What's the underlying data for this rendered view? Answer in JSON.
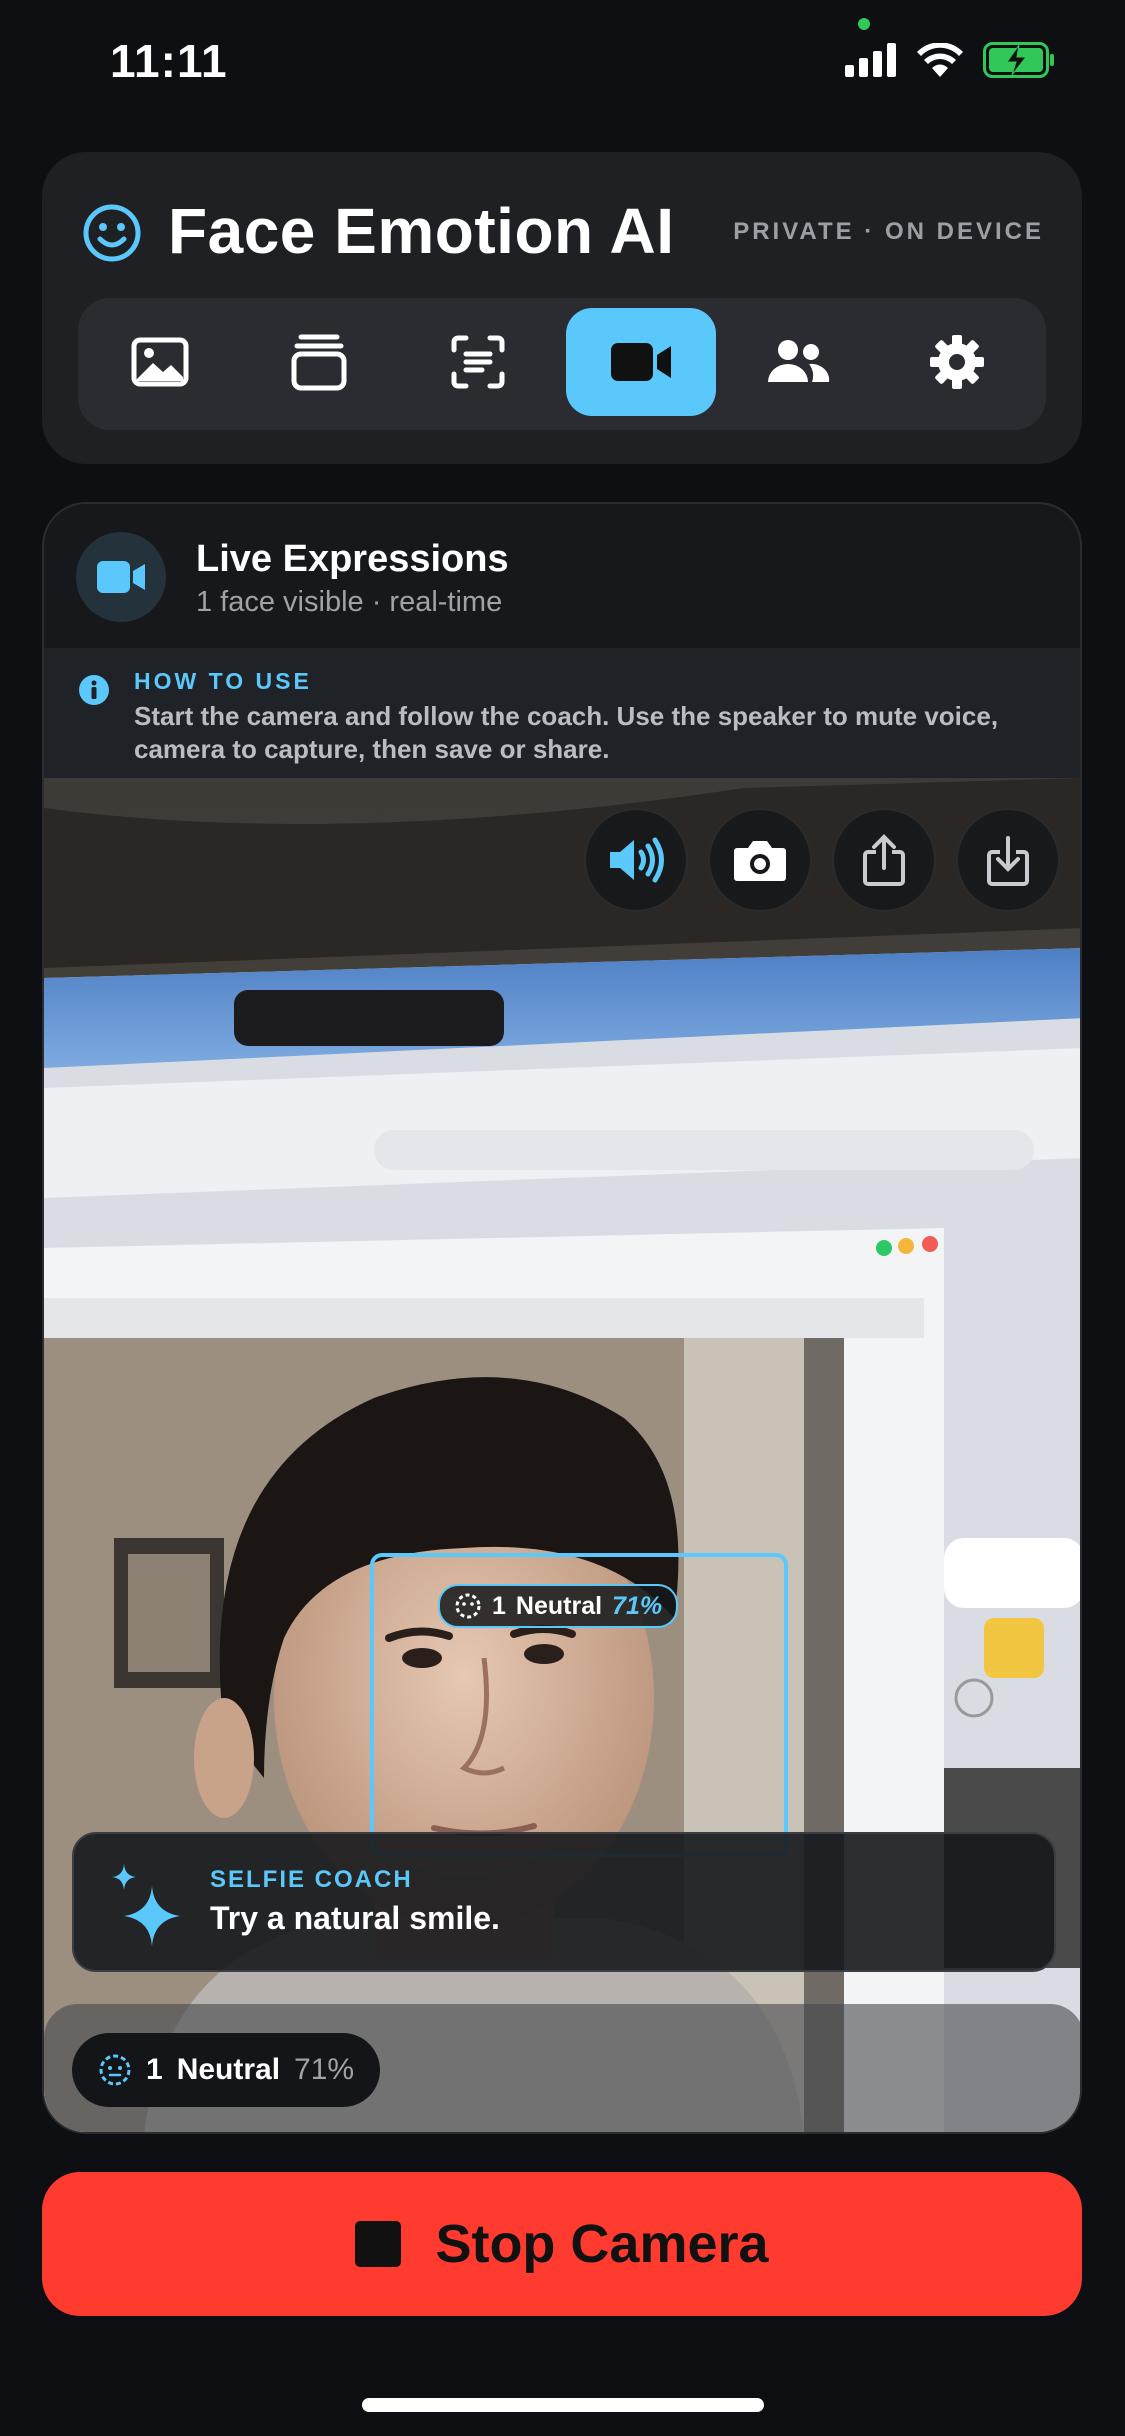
{
  "status_bar": {
    "time": "11:11"
  },
  "header": {
    "title": "Face Emotion AI",
    "privacy_badge": "PRIVATE · ON DEVICE",
    "tabs": [
      {
        "icon": "photo-icon",
        "active": false
      },
      {
        "icon": "stack-icon",
        "active": false
      },
      {
        "icon": "face-scan-icon",
        "active": false
      },
      {
        "icon": "video-camera-icon",
        "active": true
      },
      {
        "icon": "people-icon",
        "active": false
      },
      {
        "icon": "gear-icon",
        "active": false
      }
    ]
  },
  "live": {
    "title": "Live Expressions",
    "subtitle": "1 face visible · real-time"
  },
  "how_to": {
    "title": "HOW TO USE",
    "text": "Start the camera and follow the coach. Use the speaker to mute voice, camera to capture, then save or share."
  },
  "camera": {
    "controls": [
      "speaker-icon",
      "camera-icon",
      "share-icon",
      "save-icon"
    ],
    "face_label": {
      "index": "1",
      "emotion": "Neutral",
      "confidence": "71%"
    },
    "coach": {
      "title": "SELFIE COACH",
      "text": "Try a natural smile."
    },
    "summary": {
      "index": "1",
      "emotion": "Neutral",
      "confidence": "71%"
    }
  },
  "stop_button": {
    "label": "Stop Camera"
  },
  "colors": {
    "accent": "#5ac8fa",
    "stop": "#ff3b30",
    "charging": "#31c859"
  }
}
